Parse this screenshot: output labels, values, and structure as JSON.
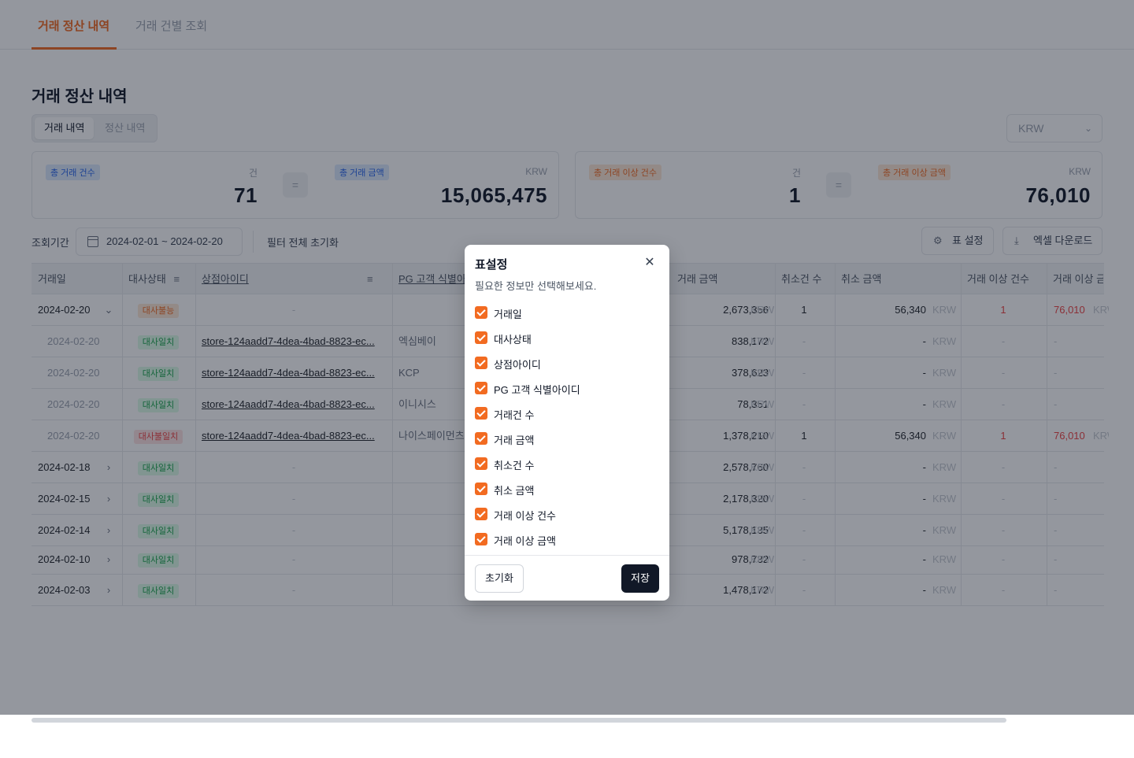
{
  "top_tabs": [
    {
      "label": "거래 정산 내역",
      "active": true
    },
    {
      "label": "거래 건별 조회",
      "active": false
    }
  ],
  "page_title": "거래 정산 내역",
  "segmented": {
    "active": "거래 내역",
    "inactive": "정산 내역"
  },
  "currency": "KRW",
  "summary": {
    "left": {
      "count_badge": "총 거래 건수",
      "count_unit": "건",
      "count_value": "71",
      "eq": "=",
      "amount_badge": "총 거래 금액",
      "amount_unit": "KRW",
      "amount_value": "15,065,475"
    },
    "right": {
      "count_badge": "총 거래 이상 건수",
      "count_unit": "건",
      "count_value": "1",
      "eq": "=",
      "amount_badge": "총 거래 이상 금액",
      "amount_unit": "KRW",
      "amount_value": "76,010"
    }
  },
  "filters": {
    "period_label": "조회기간",
    "date_range": "2024-02-01 ~ 2024-02-20",
    "reset_label": "필터 전체 초기화",
    "table_settings_label": "표 설정",
    "excel_label": "엑셀 다운로드"
  },
  "table": {
    "headers": {
      "date": "거래일",
      "status": "대사상태",
      "store": "상점아이디",
      "pg": "PG 고객 식별아이디",
      "amount": "거래 금액",
      "cancel_count": "취소건 수",
      "cancel_amount": "취소 금액",
      "anomaly_count": "거래 이상 건수",
      "anomaly_amount": "거래 이상 금액"
    },
    "currency_suffix": "KRW",
    "dash": "-",
    "rows": [
      {
        "date": "2024-02-20",
        "expander": "⌄",
        "status": "대사불능",
        "status_type": "orange",
        "store": "-",
        "pg": "",
        "amount": "2,673,356",
        "cancel_count": "1",
        "cancel_amount": "56,340",
        "anomaly_count": "1",
        "anomaly_amount": "76,010",
        "sub": false
      },
      {
        "date": "2024-02-20",
        "expander": "",
        "status": "대사일치",
        "status_type": "green",
        "store": "store-124aadd7-4dea-4bad-8823-ec...",
        "pg": "엑심베이",
        "amount": "838,172",
        "cancel_count": "-",
        "cancel_amount": "-",
        "anomaly_count": "-",
        "anomaly_amount": "-",
        "sub": true
      },
      {
        "date": "2024-02-20",
        "expander": "",
        "status": "대사일치",
        "status_type": "green",
        "store": "store-124aadd7-4dea-4bad-8823-ec...",
        "pg": "KCP",
        "amount": "378,623",
        "cancel_count": "-",
        "cancel_amount": "-",
        "anomaly_count": "-",
        "anomaly_amount": "-",
        "sub": true
      },
      {
        "date": "2024-02-20",
        "expander": "",
        "status": "대사일치",
        "status_type": "green",
        "store": "store-124aadd7-4dea-4bad-8823-ec...",
        "pg": "이니시스",
        "amount": "78,351",
        "cancel_count": "-",
        "cancel_amount": "-",
        "anomaly_count": "-",
        "anomaly_amount": "-",
        "sub": true
      },
      {
        "date": "2024-02-20",
        "expander": "",
        "status": "대사불일치",
        "status_type": "red",
        "store": "store-124aadd7-4dea-4bad-8823-ec...",
        "pg": "나이스페이먼츠",
        "amount": "1,378,210",
        "cancel_count": "1",
        "cancel_amount": "56,340",
        "anomaly_count": "1",
        "anomaly_amount": "76,010",
        "sub": true
      },
      {
        "date": "2024-02-18",
        "expander": "›",
        "status": "대사일치",
        "status_type": "green",
        "store": "-",
        "pg": "",
        "amount": "2,578,760",
        "cancel_count": "-",
        "cancel_amount": "-",
        "anomaly_count": "-",
        "anomaly_amount": "-",
        "sub": false
      },
      {
        "date": "2024-02-15",
        "expander": "›",
        "status": "대사일치",
        "status_type": "green",
        "store": "-",
        "pg": "",
        "amount": "2,178,320",
        "cancel_count": "-",
        "cancel_amount": "-",
        "anomaly_count": "-",
        "anomaly_amount": "-",
        "sub": false
      },
      {
        "date": "2024-02-14",
        "expander": "›",
        "status": "대사일치",
        "status_type": "green",
        "store": "-",
        "pg": "",
        "amount": "5,178,135",
        "cancel_count": "-",
        "cancel_amount": "-",
        "anomaly_count": "-",
        "anomaly_amount": "-",
        "sub": false
      },
      {
        "date": "2024-02-10",
        "expander": "›",
        "status": "대사일치",
        "status_type": "green",
        "store": "-",
        "pg": "",
        "amount": "978,732",
        "cancel_count": "-",
        "cancel_amount": "-",
        "anomaly_count": "-",
        "anomaly_amount": "-",
        "sub": false
      },
      {
        "date": "2024-02-03",
        "expander": "›",
        "status": "대사일치",
        "status_type": "green",
        "store": "-",
        "pg": "",
        "amount": "1,478,172",
        "cancel_count": "-",
        "cancel_amount": "-",
        "anomaly_count": "-",
        "anomaly_amount": "-",
        "sub": false
      }
    ]
  },
  "modal": {
    "title": "표설정",
    "close_icon": "close-icon",
    "subtitle": "필요한 정보만 선택해보세요.",
    "options": [
      {
        "label": "거래일",
        "checked": true
      },
      {
        "label": "대사상태",
        "checked": true
      },
      {
        "label": "상점아이디",
        "checked": true
      },
      {
        "label": "PG 고객 식별아이디",
        "checked": true
      },
      {
        "label": "거래건 수",
        "checked": true
      },
      {
        "label": "거래 금액",
        "checked": true
      },
      {
        "label": "취소건 수",
        "checked": true
      },
      {
        "label": "취소 금액",
        "checked": true
      },
      {
        "label": "거래 이상 건수",
        "checked": true
      },
      {
        "label": "거래 이상 금액",
        "checked": true
      }
    ],
    "reset_label": "초기화",
    "save_label": "저장"
  },
  "colors": {
    "accent": "#f26b21",
    "dark": "#111827",
    "overlay": "rgba(17,24,39,0.45)"
  }
}
